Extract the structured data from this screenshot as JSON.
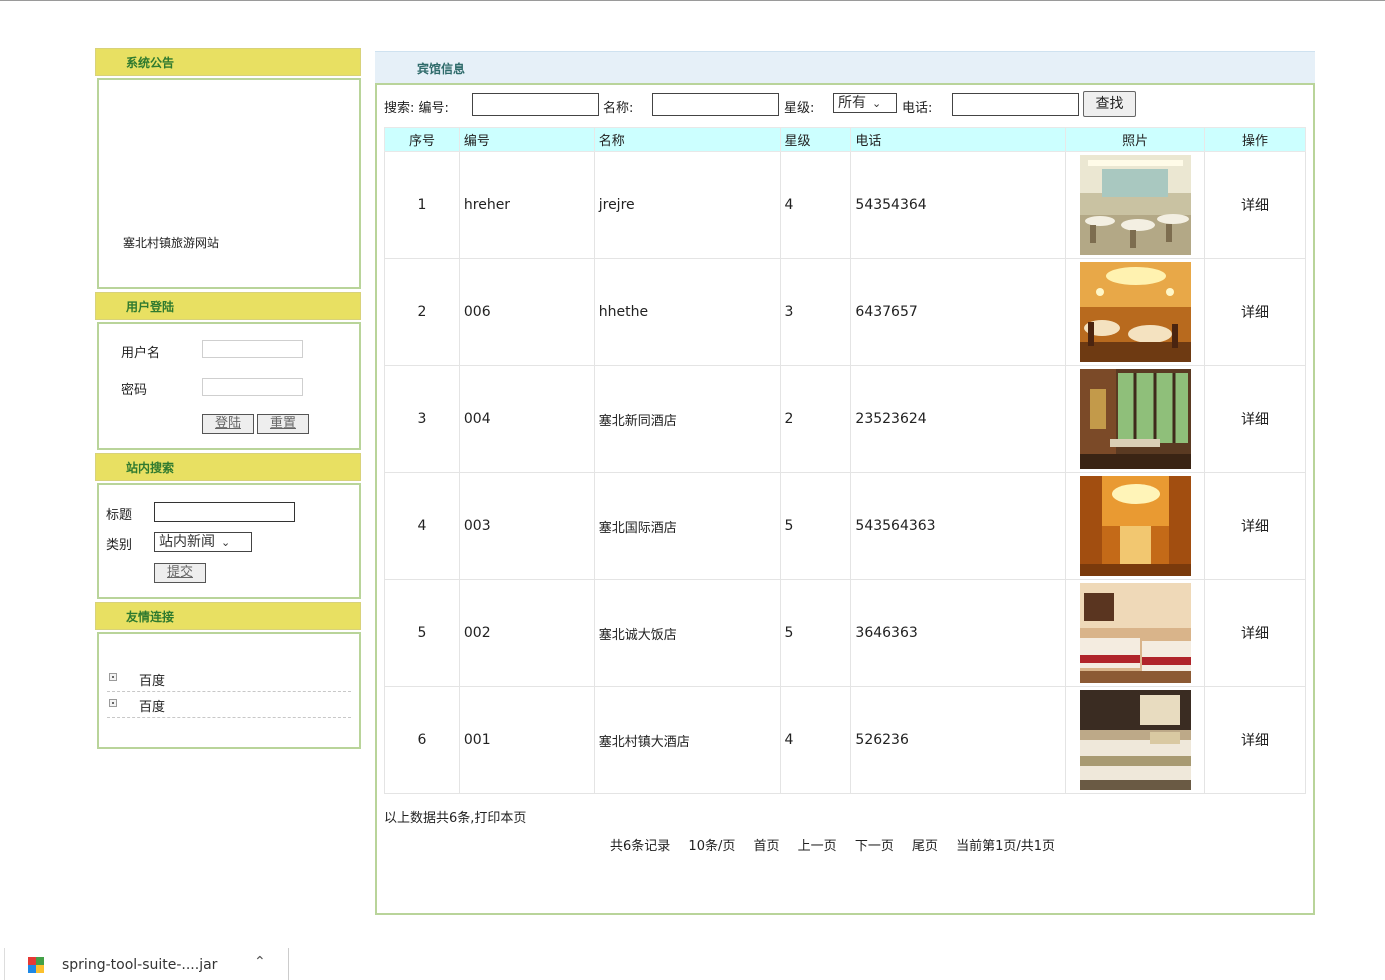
{
  "sidebar": {
    "notice": {
      "heading": "系统公告",
      "text": "塞北村镇旅游网站"
    },
    "login": {
      "heading": "用户登陆",
      "username_label": "用户名",
      "password_label": "密码",
      "login_btn": "登陆",
      "reset_btn": "重置"
    },
    "search": {
      "heading": "站内搜索",
      "title_label": "标题",
      "type_label": "类别",
      "type_selected": "站内新闻",
      "submit_btn": "提交"
    },
    "links": {
      "heading": "友情连接",
      "items": [
        {
          "label": "百度"
        },
        {
          "label": "百度"
        }
      ]
    }
  },
  "main": {
    "heading": "宾馆信息",
    "filter": {
      "search_label": "搜索: 编号:",
      "name_label": "名称:",
      "star_label": "星级:",
      "star_selected": "所有",
      "phone_label": "电话:",
      "find_btn": "查找"
    },
    "table": {
      "columns": [
        "序号",
        "编号",
        "名称",
        "星级",
        "电话",
        "照片",
        "操作"
      ],
      "rows": [
        {
          "seq": "1",
          "code": "hreher",
          "name": "jrejre",
          "star": "4",
          "phone": "54354364",
          "action": "详细",
          "photo": "dining-hall"
        },
        {
          "seq": "2",
          "code": "006",
          "name": "hhethe",
          "star": "3",
          "phone": "6437657",
          "action": "详细",
          "photo": "banquet-hall"
        },
        {
          "seq": "3",
          "code": "004",
          "name": "塞北新同酒店",
          "star": "2",
          "phone": "23523624",
          "action": "详细",
          "photo": "restaurant-window"
        },
        {
          "seq": "4",
          "code": "003",
          "name": "塞北国际酒店",
          "star": "5",
          "phone": "543564363",
          "action": "详细",
          "photo": "golden-hall"
        },
        {
          "seq": "5",
          "code": "002",
          "name": "塞北诚大饭店",
          "star": "5",
          "phone": "3646363",
          "action": "详细",
          "photo": "twin-bedroom"
        },
        {
          "seq": "6",
          "code": "001",
          "name": "塞北村镇大酒店",
          "star": "4",
          "phone": "526236",
          "action": "详细",
          "photo": "bedroom-beige"
        }
      ]
    },
    "summary": "以上数据共6条,打印本页",
    "pager": {
      "total": "共6条记录",
      "per_page": "10条/页",
      "first": "首页",
      "prev": "上一页",
      "next": "下一页",
      "last": "尾页",
      "current": "当前第1页/共1页"
    }
  },
  "download_bar": {
    "file": "spring-tool-suite-....jar"
  },
  "colors": {
    "side_header": "#e8e062",
    "side_header_text": "#2f7a2f",
    "border_green": "#b9d49a",
    "table_header": "#ccffff",
    "main_header": "#e6f0f8"
  }
}
